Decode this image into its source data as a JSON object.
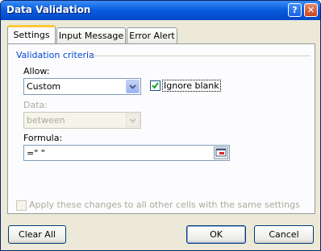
{
  "window": {
    "title": "Data Validation",
    "help_label": "?",
    "close_label": "✕"
  },
  "tabs": [
    {
      "label": "Settings",
      "active": true
    },
    {
      "label": "Input Message",
      "active": false
    },
    {
      "label": "Error Alert",
      "active": false
    }
  ],
  "criteria": {
    "group_title": "Validation criteria",
    "allow_label": "Allow:",
    "allow_value": "Custom",
    "ignore_blank_label": "Ignore blank",
    "ignore_blank_checked": true,
    "data_label": "Data:",
    "data_value": "between",
    "formula_label": "Formula:",
    "formula_value": "=\" \""
  },
  "apply_all_label": "Apply these changes to all other cells with the same settings",
  "buttons": {
    "clear_all": "Clear All",
    "ok": "OK",
    "cancel": "Cancel"
  },
  "colors": {
    "titlebar": "#0a5fe0",
    "tab_highlight": "#ffc83c",
    "group_title": "#0046d5"
  }
}
